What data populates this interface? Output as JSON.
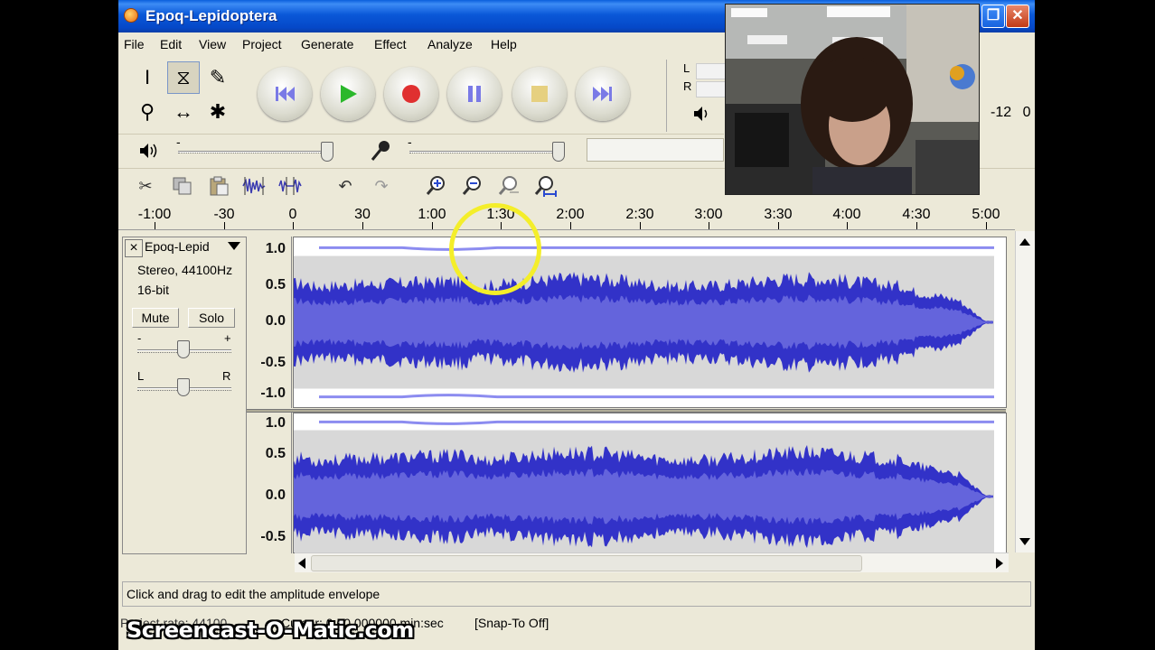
{
  "window": {
    "title": "Epoq-Lepidoptera",
    "max_glyph": "❐",
    "close_glyph": "✕"
  },
  "menu": [
    "File",
    "Edit",
    "View",
    "Project",
    "Generate",
    "Effect",
    "Analyze",
    "Help"
  ],
  "tools": [
    {
      "name": "selection-tool",
      "glyph": "I"
    },
    {
      "name": "envelope-tool",
      "glyph": "⧖"
    },
    {
      "name": "draw-tool",
      "glyph": "✎"
    },
    {
      "name": "zoom-tool",
      "glyph": "⚲"
    },
    {
      "name": "time-shift-tool",
      "glyph": "↔"
    },
    {
      "name": "multi-tool",
      "glyph": "✱"
    }
  ],
  "transport_icons": [
    "skip-start-icon",
    "play-icon",
    "record-icon",
    "pause-icon",
    "stop-icon",
    "skip-end-icon"
  ],
  "meter": {
    "left_label": "L",
    "right_label": "R",
    "scale_left": "-12",
    "scale_right": "0"
  },
  "mixer": {
    "slider_min": "-",
    "slider_max": "+"
  },
  "edit_tool_icons": [
    "cut-icon",
    "copy-icon",
    "paste-icon",
    "trim-icon",
    "silence-icon",
    "undo-icon",
    "redo-icon",
    "zoom-in-icon",
    "zoom-out-icon",
    "fit-selection-icon",
    "fit-project-icon"
  ],
  "ruler": {
    "ticks": [
      "-1:00",
      "-30",
      "0",
      "30",
      "1:00",
      "1:30",
      "2:00",
      "2:30",
      "3:00",
      "3:30",
      "4:00",
      "4:30",
      "5:00"
    ]
  },
  "track": {
    "name": "Epoq-Lepid",
    "info_line1": "Stereo, 44100Hz",
    "info_line2": "16-bit",
    "mute_label": "Mute",
    "solo_label": "Solo",
    "gain_minus": "-",
    "gain_plus": "+",
    "pan_left": "L",
    "pan_right": "R",
    "scale_top": [
      "1.0",
      "0.5",
      "0.0",
      "-0.5",
      "-1.0"
    ],
    "scale_bottom": [
      "1.0",
      "0.5",
      "0.0",
      "-0.5"
    ]
  },
  "status": {
    "text": "Click and drag to edit the amplitude envelope"
  },
  "bottom": {
    "rate": "Project rate: 44100",
    "selection": "Cursor: 0:00.000000 min:sec",
    "snap": "[Snap-To Off]"
  },
  "watermark": "Screencast-O-Matic.com",
  "colors": {
    "wave": "#3232c8",
    "wave_light": "#6464dc",
    "envelope": "#8c8cf0",
    "highlight": "#f4ee2a"
  }
}
